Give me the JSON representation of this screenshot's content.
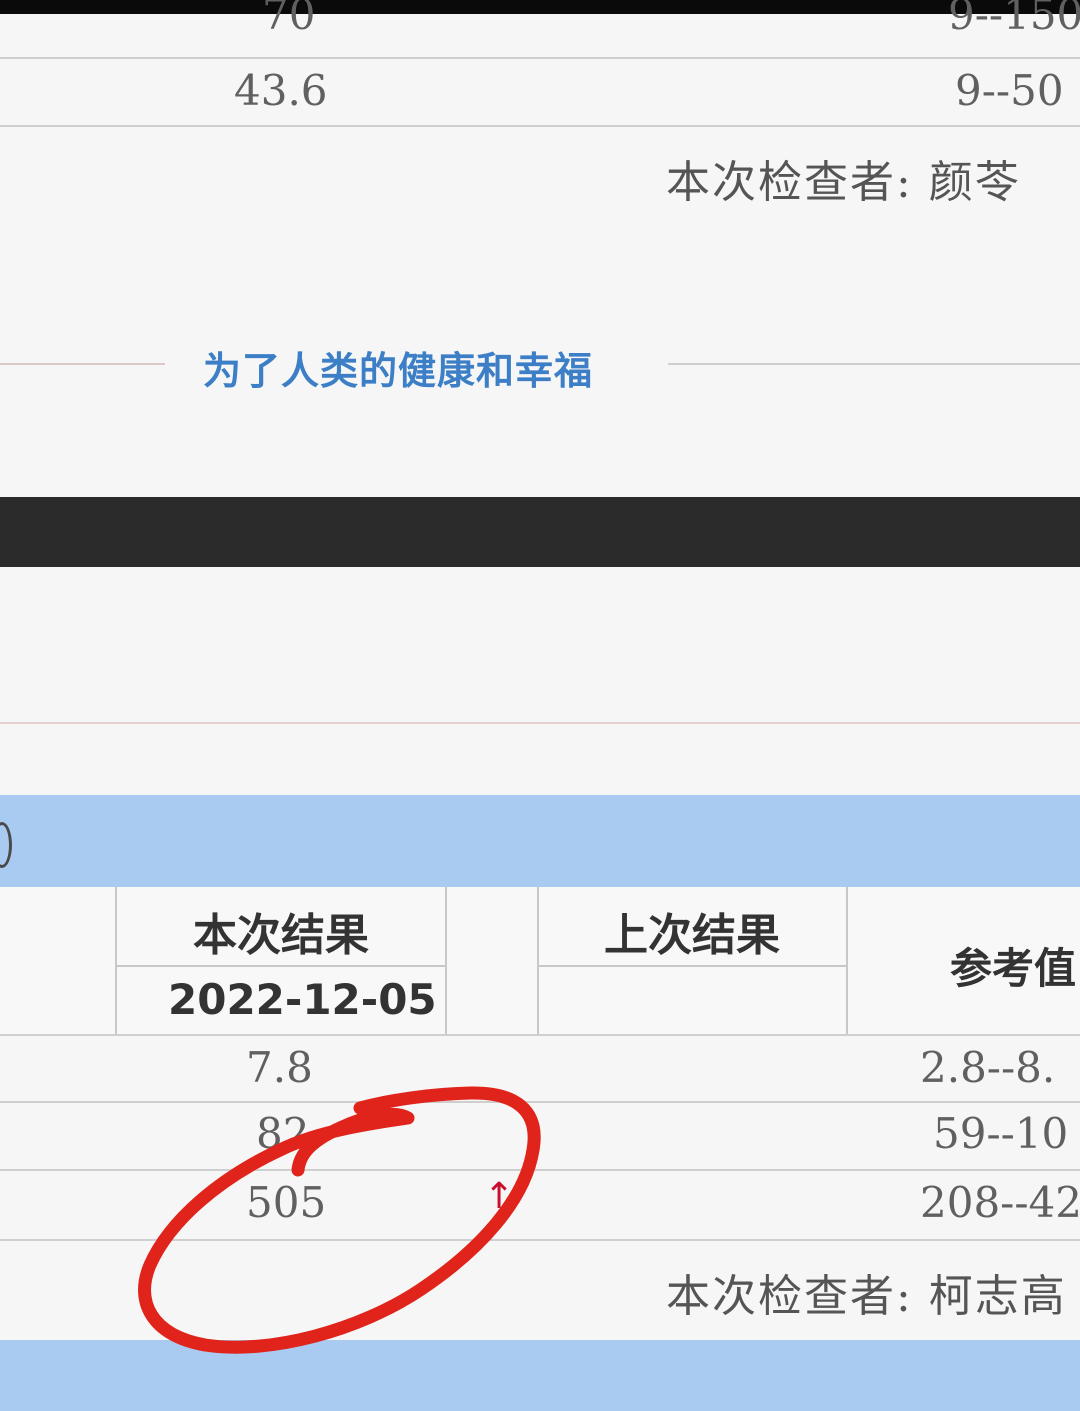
{
  "upper_table": {
    "rows": [
      {
        "value": "70",
        "reference": "9--150"
      },
      {
        "value": "43.6",
        "reference": "9--50"
      }
    ],
    "examiner": "本次检查者: 颜苓"
  },
  "slogan": "为了人类的健康和幸福",
  "lower_table": {
    "headers": {
      "current_result": "本次结果",
      "current_date": "2022-12-05",
      "previous_result": "上次结果",
      "reference_value": "参考值"
    },
    "rows": [
      {
        "value": "7.8",
        "reference": "2.8--8."
      },
      {
        "value": "82",
        "reference": "59--10"
      },
      {
        "value": "505",
        "flag": "↑",
        "reference": "208--42"
      }
    ],
    "examiner": "本次检查者: 柯志高"
  },
  "colors": {
    "header_band": "#a9cbf2",
    "slogan": "#3d7fc6",
    "annotation": "#e0241b",
    "flag": "#c8102e"
  }
}
